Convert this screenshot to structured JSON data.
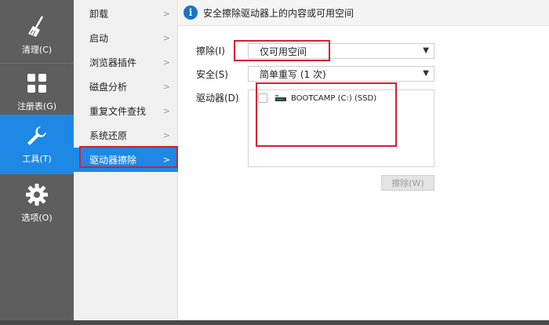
{
  "sidebar": {
    "items": [
      {
        "label": "清理(C)",
        "icon": "broom-icon",
        "active": false
      },
      {
        "label": "注册表(G)",
        "icon": "grid-icon",
        "active": false
      },
      {
        "label": "工具(T)",
        "icon": "wrench-icon",
        "active": true
      },
      {
        "label": "选项(O)",
        "icon": "gear-icon",
        "active": false
      }
    ]
  },
  "menu": {
    "items": [
      {
        "label": "卸载"
      },
      {
        "label": "启动"
      },
      {
        "label": "浏览器插件"
      },
      {
        "label": "磁盘分析"
      },
      {
        "label": "重复文件查找"
      },
      {
        "label": "系统还原"
      },
      {
        "label": "驱动器擦除",
        "active": true
      }
    ]
  },
  "header": {
    "text": "安全擦除驱动器上的内容或可用空间",
    "icon": "info-icon"
  },
  "form": {
    "wipe_label": "擦除(I)",
    "wipe_value": "仅可用空间",
    "security_label": "安全(S)",
    "security_value": "简单重写 (1 次)",
    "drives_label": "驱动器(D)",
    "drives": [
      {
        "name": "BOOTCAMP (C:) (SSD)",
        "checked": false
      }
    ],
    "wipe_button": "擦除(W)"
  },
  "colors": {
    "accent": "#1e88e5",
    "highlight_border": "#d32030",
    "sidebar_bg": "#5e5e5e"
  }
}
